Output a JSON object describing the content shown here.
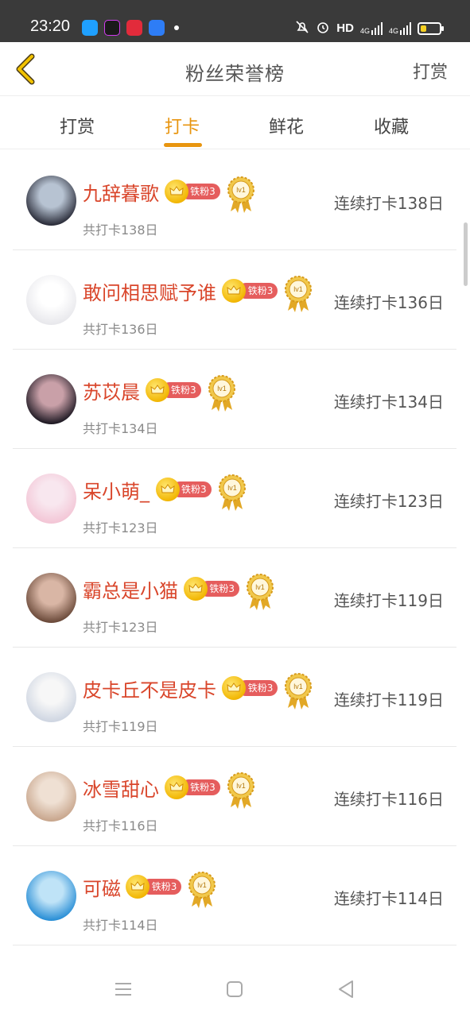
{
  "status": {
    "time": "23:20",
    "hd": "HD",
    "net1": "4G",
    "net2": "4G",
    "battery_level": 0.3
  },
  "header": {
    "title": "粉丝荣誉榜",
    "action": "打赏",
    "back_icon": "chevron-left-icon"
  },
  "tabs": [
    {
      "label": "打赏",
      "active": false
    },
    {
      "label": "打卡",
      "active": true
    },
    {
      "label": "鲜花",
      "active": false
    },
    {
      "label": "收藏",
      "active": false
    }
  ],
  "rows": [
    {
      "name": "九辞暮歌",
      "fan": "铁粉3",
      "medal": "lv1",
      "total": "共打卡138日",
      "streak": "连续打卡138日",
      "avatar": [
        "#2b2d3a",
        "#b7c3d2"
      ]
    },
    {
      "name": "敢问相思赋予谁",
      "fan": "铁粉3",
      "medal": "lv1",
      "total": "共打卡136日",
      "streak": "连续打卡136日",
      "avatar": [
        "#e8e8ec",
        "#ffffff"
      ]
    },
    {
      "name": "苏苡晨",
      "fan": "铁粉3",
      "medal": "lv1",
      "total": "共打卡134日",
      "streak": "连续打卡134日",
      "avatar": [
        "#1f1a24",
        "#c9a0a8"
      ]
    },
    {
      "name": "呆小萌_",
      "fan": "铁粉3",
      "medal": "lv1",
      "total": "共打卡123日",
      "streak": "连续打卡123日",
      "avatar": [
        "#f3c6d6",
        "#f8e7ef"
      ]
    },
    {
      "name": "霸总是小猫",
      "fan": "铁粉3",
      "medal": "lv1",
      "total": "共打卡123日",
      "streak": "连续打卡119日",
      "avatar": [
        "#6b4a3a",
        "#d9b6a5"
      ]
    },
    {
      "name": "皮卡丘不是皮卡",
      "fan": "铁粉3",
      "medal": "lv1",
      "total": "共打卡119日",
      "streak": "连续打卡119日",
      "avatar": [
        "#cfd6e2",
        "#f7f7f7"
      ]
    },
    {
      "name": "冰雪甜心",
      "fan": "铁粉3",
      "medal": "lv1",
      "total": "共打卡116日",
      "streak": "连续打卡116日",
      "avatar": [
        "#c8a68d",
        "#efe0d3"
      ]
    },
    {
      "name": "可磁",
      "fan": "铁粉3",
      "medal": "lv1",
      "total": "共打卡114日",
      "streak": "连续打卡114日",
      "avatar": [
        "#2a8fd6",
        "#bfe3f7"
      ]
    }
  ],
  "sysnav": {
    "menu_icon": "menu-icon",
    "home_icon": "square-icon",
    "back_icon": "triangle-back-icon"
  }
}
